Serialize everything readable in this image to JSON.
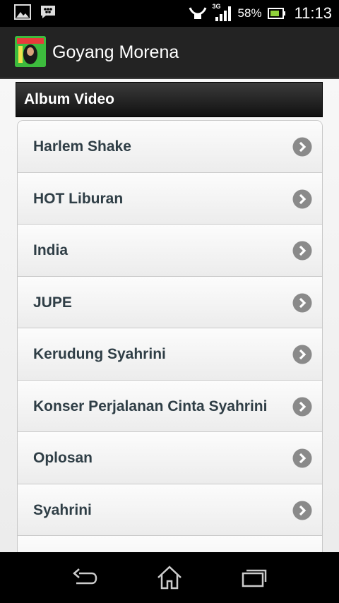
{
  "status_bar": {
    "network_type": "3G",
    "battery_percent": "58%",
    "time": "11:13",
    "icons": [
      "image-icon",
      "bbm-icon",
      "wifi-shield-icon",
      "signal-icon",
      "battery-icon"
    ]
  },
  "action_bar": {
    "app_icon": "app-logo-icon",
    "title": "Goyang Morena"
  },
  "section": {
    "header": "Album Video"
  },
  "list": {
    "items": [
      {
        "label": "Harlem Shake"
      },
      {
        "label": "HOT Liburan"
      },
      {
        "label": "India"
      },
      {
        "label": "JUPE"
      },
      {
        "label": "Kerudung Syahrini"
      },
      {
        "label": "Konser Perjalanan Cinta Syahrini"
      },
      {
        "label": "Oplosan"
      },
      {
        "label": "Syahrini"
      },
      {
        "label": ""
      }
    ],
    "item_icon": "chevron-right-circle-icon"
  },
  "nav_bar": {
    "buttons": [
      "back-icon",
      "home-icon",
      "recent-apps-icon"
    ]
  },
  "colors": {
    "action_bar": "#232323",
    "header_bar": "#1f1f1f",
    "list_text": "#2f3e46",
    "chevron": "#8a8a8a"
  }
}
